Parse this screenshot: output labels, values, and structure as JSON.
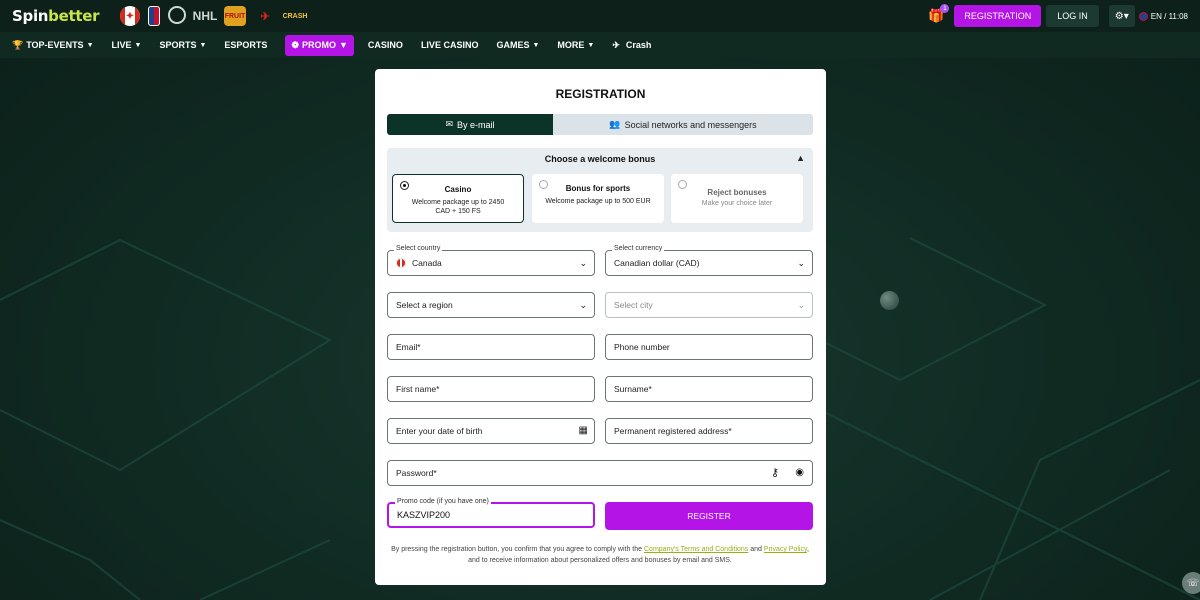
{
  "brand": {
    "logo_part1": "Spin",
    "logo_part2": "better"
  },
  "header": {
    "flag_nhl": "NHL",
    "flag_slot": "FRUIT",
    "flag_crash": "CRASH",
    "gift_badge": "1",
    "registration_label": "REGISTRATION",
    "login_label": "LOG IN",
    "language_time": "EN / 11:08"
  },
  "nav": {
    "items": [
      {
        "label": "TOP-EVENTS"
      },
      {
        "label": "LIVE"
      },
      {
        "label": "SPORTS"
      },
      {
        "label": "ESPORTS"
      },
      {
        "label": "PROMO"
      },
      {
        "label": "CASINO"
      },
      {
        "label": "LIVE CASINO"
      },
      {
        "label": "GAMES"
      },
      {
        "label": "MORE"
      },
      {
        "label": "Crash"
      }
    ]
  },
  "modal": {
    "title": "REGISTRATION",
    "tabs": [
      {
        "label": "By e-mail",
        "active": true
      },
      {
        "label": "Social networks and messengers",
        "active": false
      }
    ],
    "bonus": {
      "heading": "Choose a welcome bonus",
      "options": [
        {
          "title": "Casino",
          "desc": "Welcome package up to 2450 CAD + 150 FS",
          "selected": true
        },
        {
          "title": "Bonus for sports",
          "desc": "Welcome package up to 500 EUR",
          "selected": false
        },
        {
          "title": "Reject bonuses",
          "desc": "Make your choice later",
          "selected": false
        }
      ]
    },
    "fields": {
      "country_label": "Select country",
      "country_value": "Canada",
      "currency_label": "Select currency",
      "currency_value": "Canadian dollar (CAD)",
      "region_placeholder": "Select a region",
      "city_placeholder": "Select city",
      "email_placeholder": "Email*",
      "phone_placeholder": "Phone number",
      "firstname_placeholder": "First name*",
      "surname_placeholder": "Surname*",
      "dob_placeholder": "Enter your date of birth",
      "address_placeholder": "Permanent registered address*",
      "password_placeholder": "Password*",
      "promo_label": "Promo code (if you have one)",
      "promo_value": "KASZVIP200"
    },
    "register_label": "REGISTER",
    "legal": {
      "text1": "By pressing the registration button, you confirm that you agree to comply with the ",
      "terms_link": "Company's Terms and Conditions",
      "text2": " and ",
      "privacy_link": "Privacy Policy",
      "text3": ", and to receive information about personalized offers and bonuses by email and SMS."
    }
  },
  "colors": {
    "accent": "#b414e6",
    "dark_green": "#0c3327",
    "background": "#0f2a22"
  }
}
